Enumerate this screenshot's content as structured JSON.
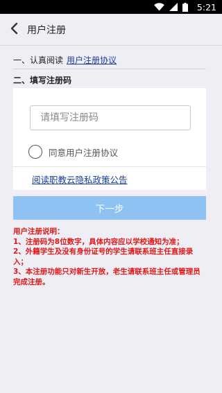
{
  "status_bar": {
    "time": "5:21"
  },
  "header": {
    "title": "用户注册"
  },
  "step1": {
    "prefix": "一、认真阅读",
    "link": "用户注册协议"
  },
  "step2": {
    "label": "二、填写注册码"
  },
  "form": {
    "code_placeholder": "请填写注册码",
    "agree_label": "同意用户注册协议",
    "privacy_link": "阅读职教云隐私政策公告"
  },
  "next_button": {
    "label": "下一步"
  },
  "notes": {
    "title": "用户注册说明：",
    "items": [
      "1、注册码为8位数字，具体内容应以学校通知为准；",
      "2、外籍学生及没有身份证号的学生请联系班主任直接录入；",
      "3、本注册功能只对新生开放，老生请联系班主任或管理员完成注册。"
    ]
  },
  "colors": {
    "background": "#efeef4",
    "link": "#1a3c9c",
    "button": "#8ec2f2",
    "notes": "#e01818"
  }
}
